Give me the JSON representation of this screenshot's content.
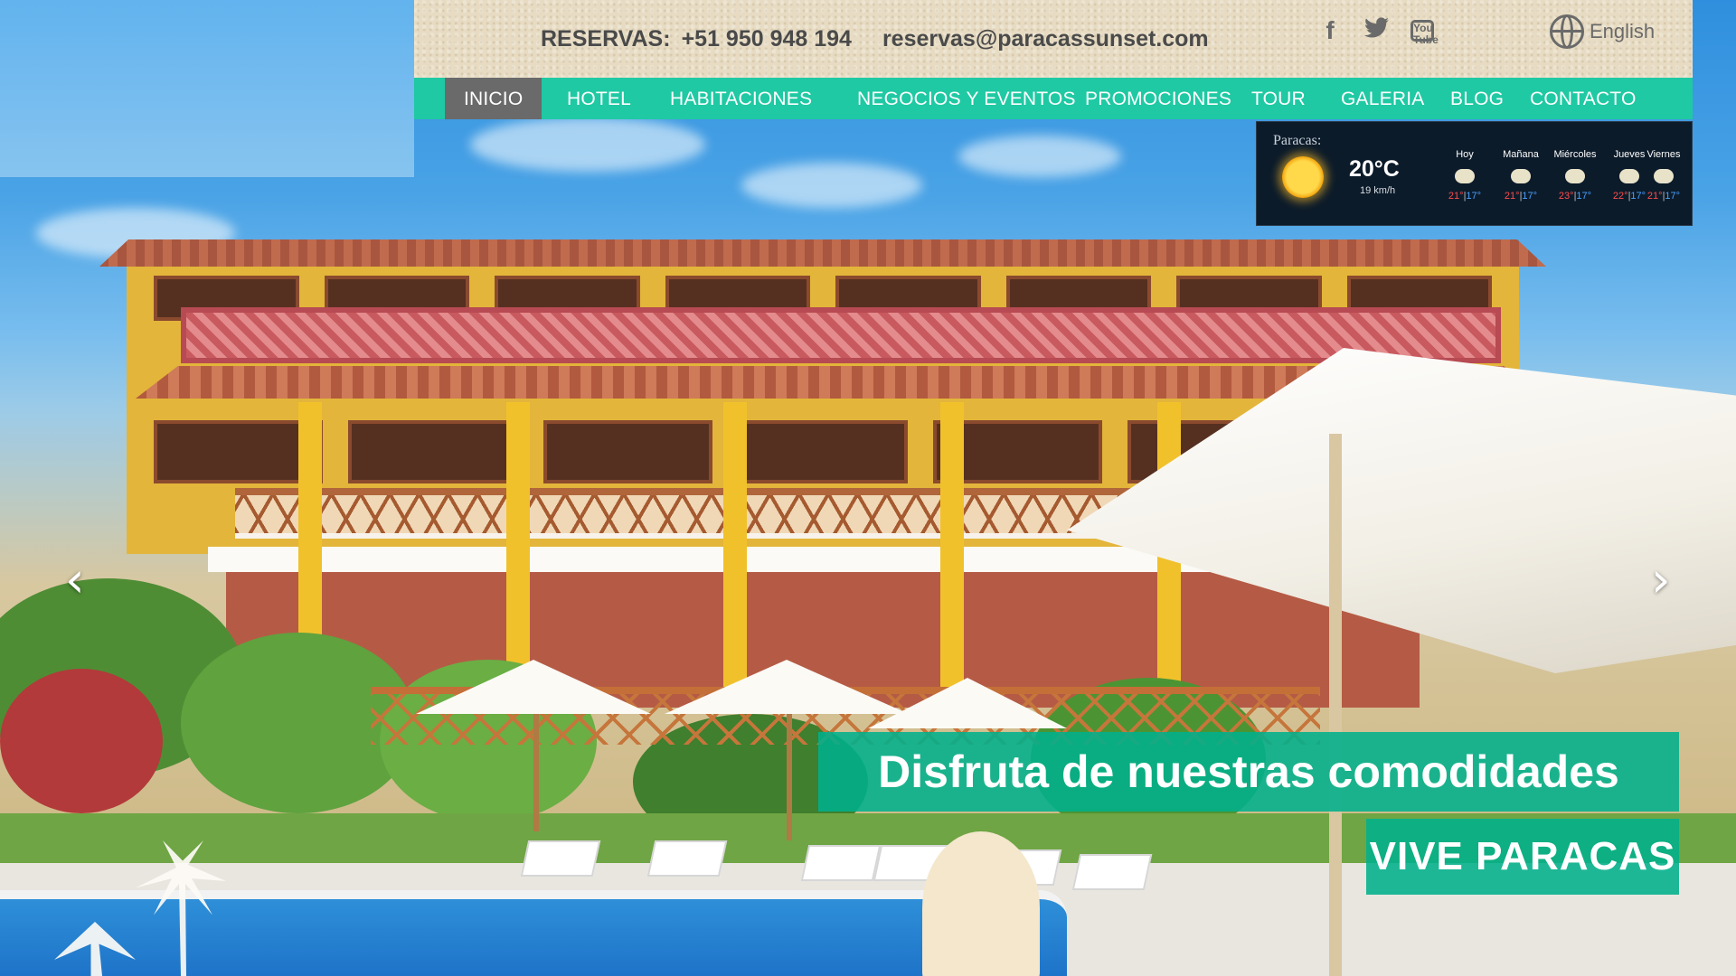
{
  "topbar": {
    "reservas_label": "RESERVAS:",
    "phone": "+51 950 948 194",
    "email": "reservas@paracassunset.com",
    "social_icons": [
      "facebook-icon",
      "twitter-icon",
      "youtube-icon"
    ],
    "language": "English"
  },
  "nav": {
    "items": [
      {
        "label": "INICIO",
        "active": true
      },
      {
        "label": "HOTEL"
      },
      {
        "label": "HABITACIONES"
      },
      {
        "label": "NEGOCIOS Y EVENTOS"
      },
      {
        "label": "PROMOCIONES"
      },
      {
        "label": "TOUR"
      },
      {
        "label": "GALERIA"
      },
      {
        "label": "BLOG"
      },
      {
        "label": "CONTACTO"
      }
    ],
    "active_color": "#6a6a6a",
    "bar_color": "#1fc9a3"
  },
  "weather": {
    "city": "Paracas:",
    "temp": "20°C",
    "wind": "19 km/h",
    "icon": "sun-icon",
    "forecast": [
      {
        "day": "Hoy",
        "hi": "21°",
        "lo": "17°"
      },
      {
        "day": "Mañana",
        "hi": "21°",
        "lo": "17°"
      },
      {
        "day": "Miércoles",
        "hi": "23°",
        "lo": "17°"
      },
      {
        "day": "Jueves",
        "hi": "22°",
        "lo": "17°"
      },
      {
        "day": "Viernes",
        "hi": "21°",
        "lo": "17°"
      }
    ]
  },
  "slider": {
    "prev": "‹",
    "next": "›",
    "caption_main": "Disfruta de nuestras comodidades",
    "caption_sub": "VIVE PARACAS",
    "caption_color": "#00b08c"
  }
}
